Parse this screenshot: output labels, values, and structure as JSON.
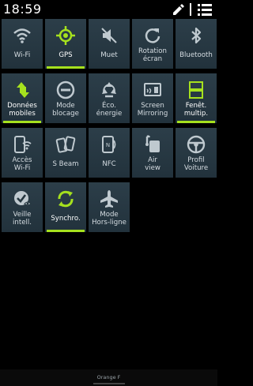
{
  "status_bar": {
    "time": "18:59",
    "icons": [
      "edit-icon",
      "menu-icon"
    ]
  },
  "colors": {
    "tile_bg": "#283a45",
    "active_accent": "#a6e11e",
    "inactive_icon": "#bfc9cf"
  },
  "quick_settings": [
    {
      "label": "Wi-Fi",
      "icon": "wifi-icon",
      "active": false
    },
    {
      "label": "GPS",
      "icon": "gps-icon",
      "active": true
    },
    {
      "label": "Muet",
      "icon": "mute-icon",
      "active": false
    },
    {
      "label": "Rotation\nécran",
      "icon": "rotation-icon",
      "active": false
    },
    {
      "label": "Bluetooth",
      "icon": "bluetooth-icon",
      "active": false
    },
    {
      "label": "Données\nmobiles",
      "icon": "mobile-data-icon",
      "active": true
    },
    {
      "label": "Mode\nblocage",
      "icon": "block-mode-icon",
      "active": false
    },
    {
      "label": "Éco.\nénergie",
      "icon": "power-saving-icon",
      "active": false
    },
    {
      "label": "Screen\nMirroring",
      "icon": "screen-mirroring-icon",
      "active": false
    },
    {
      "label": "Fenêt.\nmultip.",
      "icon": "multi-window-icon",
      "active": true
    },
    {
      "label": "Accès\nWi-Fi",
      "icon": "wifi-hotspot-icon",
      "active": false
    },
    {
      "label": "S Beam",
      "icon": "s-beam-icon",
      "active": false
    },
    {
      "label": "NFC",
      "icon": "nfc-icon",
      "active": false
    },
    {
      "label": "Air\nview",
      "icon": "air-view-icon",
      "active": false
    },
    {
      "label": "Profil\nVoiture",
      "icon": "car-mode-icon",
      "active": false
    },
    {
      "label": "Veille\nintell.",
      "icon": "smart-stay-icon",
      "active": false
    },
    {
      "label": "Synchro.",
      "icon": "sync-icon",
      "active": true
    },
    {
      "label": "Mode\nHors-ligne",
      "icon": "airplane-mode-icon",
      "active": false
    }
  ],
  "carrier": "Orange F"
}
